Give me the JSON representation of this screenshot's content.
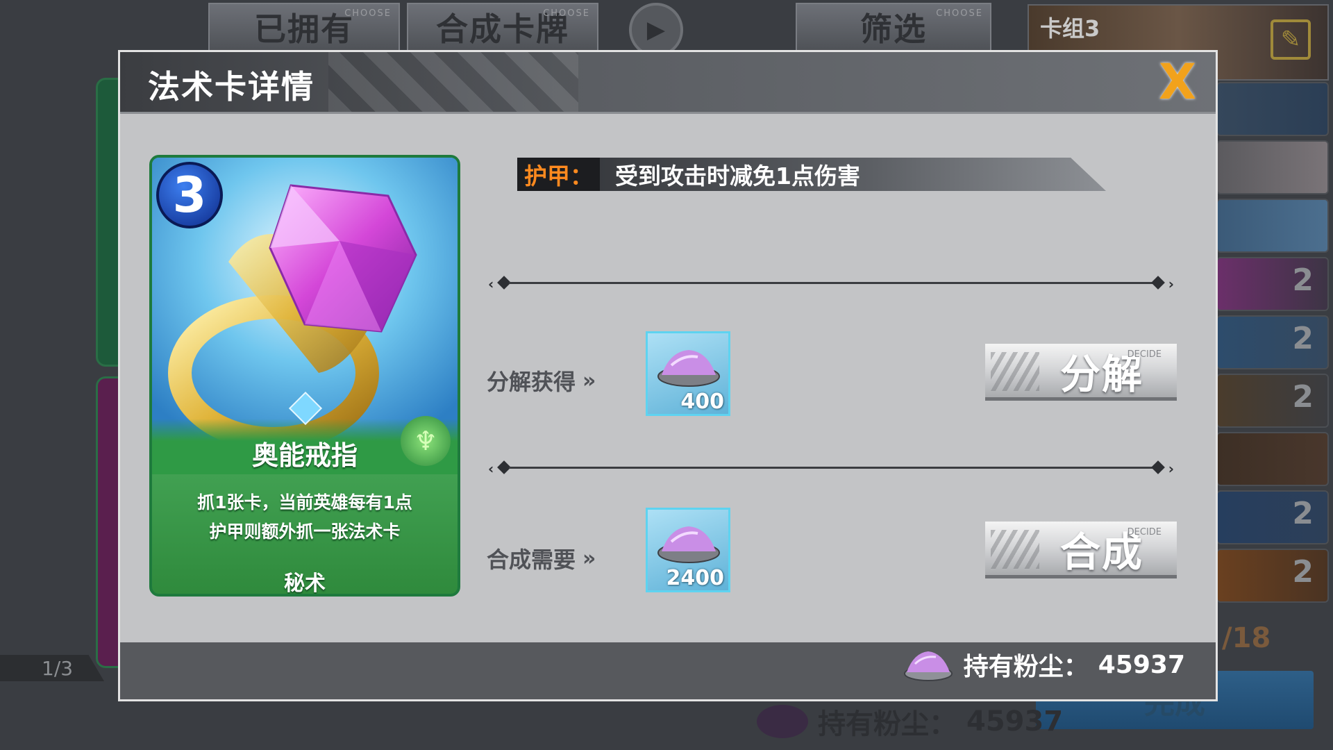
{
  "background": {
    "tabs": [
      {
        "label": "已拥有",
        "tag": "CHOOSE"
      },
      {
        "label": "合成卡牌",
        "tag": "CHOOSE"
      },
      {
        "label": "筛选",
        "tag": "CHOOSE"
      }
    ],
    "deck_title": "卡组3",
    "deck_counts": [
      "2",
      "2",
      "2",
      "2",
      "2"
    ],
    "page_indicator": "1/3",
    "card_count": "/18",
    "done_label": "完成",
    "dust_label": "持有粉尘：",
    "dust_value": "45937"
  },
  "modal": {
    "title": "法术卡详情",
    "close_label": "X",
    "card": {
      "cost": "3",
      "name": "奥能戒指",
      "description_line1": "抓1张卡，当前英雄每有1点",
      "description_line2": "护甲则额外抓一张法术卡",
      "type": "秘术"
    },
    "keyword": {
      "label": "护甲：",
      "text": "受到攻击时减免1点伤害"
    },
    "disenchant": {
      "label": "分解获得",
      "amount": "400",
      "button": "分解",
      "button_tag": "DECIDE"
    },
    "craft": {
      "label": "合成需要",
      "amount": "2400",
      "button": "合成",
      "button_tag": "DECIDE"
    },
    "footer": {
      "dust_label": "持有粉尘：",
      "dust_value": "45937"
    }
  },
  "colors": {
    "accent_orange": "#f2a21c",
    "keyword_orange": "#ff8a1f",
    "card_green": "#1e7a3d",
    "dust_box_border": "#5ed3f0"
  }
}
